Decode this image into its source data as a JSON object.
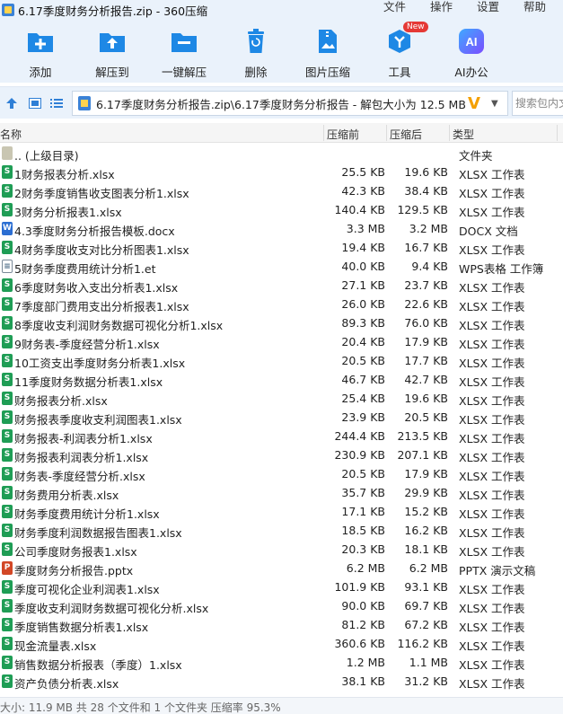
{
  "window": {
    "title": "6.17季度财务分析报告.zip - 360压缩",
    "menus": [
      "文件",
      "操作",
      "设置",
      "帮助"
    ]
  },
  "toolbar": {
    "items": [
      {
        "label": "添加",
        "icon": "add-icon"
      },
      {
        "label": "解压到",
        "icon": "extract-to-icon"
      },
      {
        "label": "一键解压",
        "icon": "one-click-extract-icon"
      },
      {
        "label": "删除",
        "icon": "delete-icon"
      },
      {
        "label": "图片压缩",
        "icon": "image-compress-icon"
      },
      {
        "label": "工具",
        "icon": "tools-icon",
        "badge": "New"
      },
      {
        "label": "AI办公",
        "icon": "ai-office-icon"
      }
    ]
  },
  "address": {
    "path": "6.17季度财务分析报告.zip\\6.17季度财务分析报告 - 解包大小为 12.5 MB",
    "search_placeholder": "搜索包内文"
  },
  "columns": {
    "name": "名称",
    "size": "压缩前",
    "packed": "压缩后",
    "type": "类型"
  },
  "files": [
    {
      "name": ".. (上级目录)",
      "size": "",
      "packed": "",
      "type": "文件夹",
      "kind": "folder"
    },
    {
      "name": "1财务报表分析.xlsx",
      "size": "25.5 KB",
      "packed": "19.6 KB",
      "type": "XLSX 工作表",
      "kind": "xlsx"
    },
    {
      "name": "2财务季度销售收支图表分析1.xlsx",
      "size": "42.3 KB",
      "packed": "38.4 KB",
      "type": "XLSX 工作表",
      "kind": "xlsx"
    },
    {
      "name": "3财务分析报表1.xlsx",
      "size": "140.4 KB",
      "packed": "129.5 KB",
      "type": "XLSX 工作表",
      "kind": "xlsx"
    },
    {
      "name": "4.3季度财务分析报告模板.docx",
      "size": "3.3 MB",
      "packed": "3.2 MB",
      "type": "DOCX 文档",
      "kind": "docx"
    },
    {
      "name": "4财务季度收支对比分析图表1.xlsx",
      "size": "19.4 KB",
      "packed": "16.7 KB",
      "type": "XLSX 工作表",
      "kind": "xlsx"
    },
    {
      "name": "5财务季度费用统计分析1.et",
      "size": "40.0 KB",
      "packed": "9.4 KB",
      "type": "WPS表格 工作簿",
      "kind": "et"
    },
    {
      "name": "6季度财务收入支出分析表1.xlsx",
      "size": "27.1 KB",
      "packed": "23.7 KB",
      "type": "XLSX 工作表",
      "kind": "xlsx"
    },
    {
      "name": "7季度部门费用支出分析报表1.xlsx",
      "size": "26.0 KB",
      "packed": "22.6 KB",
      "type": "XLSX 工作表",
      "kind": "xlsx"
    },
    {
      "name": "8季度收支利润财务数据可视化分析1.xlsx",
      "size": "89.3 KB",
      "packed": "76.0 KB",
      "type": "XLSX 工作表",
      "kind": "xlsx"
    },
    {
      "name": "9财务表-季度经营分析1.xlsx",
      "size": "20.4 KB",
      "packed": "17.9 KB",
      "type": "XLSX 工作表",
      "kind": "xlsx"
    },
    {
      "name": "10工资支出季度财务分析表1.xlsx",
      "size": "20.5 KB",
      "packed": "17.7 KB",
      "type": "XLSX 工作表",
      "kind": "xlsx"
    },
    {
      "name": "11季度财务数据分析表1.xlsx",
      "size": "46.7 KB",
      "packed": "42.7 KB",
      "type": "XLSX 工作表",
      "kind": "xlsx"
    },
    {
      "name": "财务报表分析.xlsx",
      "size": "25.4 KB",
      "packed": "19.6 KB",
      "type": "XLSX 工作表",
      "kind": "xlsx"
    },
    {
      "name": "财务报表季度收支利润图表1.xlsx",
      "size": "23.9 KB",
      "packed": "20.5 KB",
      "type": "XLSX 工作表",
      "kind": "xlsx"
    },
    {
      "name": "财务报表-利润表分析1.xlsx",
      "size": "244.4 KB",
      "packed": "213.5 KB",
      "type": "XLSX 工作表",
      "kind": "xlsx"
    },
    {
      "name": "财务报表利润表分析1.xlsx",
      "size": "230.9 KB",
      "packed": "207.1 KB",
      "type": "XLSX 工作表",
      "kind": "xlsx"
    },
    {
      "name": "财务表-季度经营分析.xlsx",
      "size": "20.5 KB",
      "packed": "17.9 KB",
      "type": "XLSX 工作表",
      "kind": "xlsx"
    },
    {
      "name": "财务费用分析表.xlsx",
      "size": "35.7 KB",
      "packed": "29.9 KB",
      "type": "XLSX 工作表",
      "kind": "xlsx"
    },
    {
      "name": "财务季度费用统计分析1.xlsx",
      "size": "17.1 KB",
      "packed": "15.2 KB",
      "type": "XLSX 工作表",
      "kind": "xlsx"
    },
    {
      "name": "财务季度利润数据报告图表1.xlsx",
      "size": "18.5 KB",
      "packed": "16.2 KB",
      "type": "XLSX 工作表",
      "kind": "xlsx"
    },
    {
      "name": "公司季度财务报表1.xlsx",
      "size": "20.3 KB",
      "packed": "18.1 KB",
      "type": "XLSX 工作表",
      "kind": "xlsx"
    },
    {
      "name": "季度财务分析报告.pptx",
      "size": "6.2 MB",
      "packed": "6.2 MB",
      "type": "PPTX 演示文稿",
      "kind": "pptx"
    },
    {
      "name": "季度可视化企业利润表1.xlsx",
      "size": "101.9 KB",
      "packed": "93.1 KB",
      "type": "XLSX 工作表",
      "kind": "xlsx"
    },
    {
      "name": "季度收支利润财务数据可视化分析.xlsx",
      "size": "90.0 KB",
      "packed": "69.7 KB",
      "type": "XLSX 工作表",
      "kind": "xlsx"
    },
    {
      "name": "季度销售数据分析表1.xlsx",
      "size": "81.2 KB",
      "packed": "67.2 KB",
      "type": "XLSX 工作表",
      "kind": "xlsx"
    },
    {
      "name": "现金流量表.xlsx",
      "size": "360.6 KB",
      "packed": "116.2 KB",
      "type": "XLSX 工作表",
      "kind": "xlsx"
    },
    {
      "name": "销售数据分析报表（季度）1.xlsx",
      "size": "1.2 MB",
      "packed": "1.1 MB",
      "type": "XLSX 工作表",
      "kind": "xlsx"
    },
    {
      "name": "资产负债分析表.xlsx",
      "size": "38.1 KB",
      "packed": "31.2 KB",
      "type": "XLSX 工作表",
      "kind": "xlsx"
    }
  ],
  "status": {
    "text": "大小: 11.9 MB 共 28 个文件和 1 个文件夹 压缩率 95.3%"
  },
  "colors": {
    "toolbar_bg": "#eaf2fb",
    "xlsx": "#1f9d55",
    "docx": "#2b6ed2",
    "pptx": "#d24726",
    "accent": "#2f7fd6"
  }
}
